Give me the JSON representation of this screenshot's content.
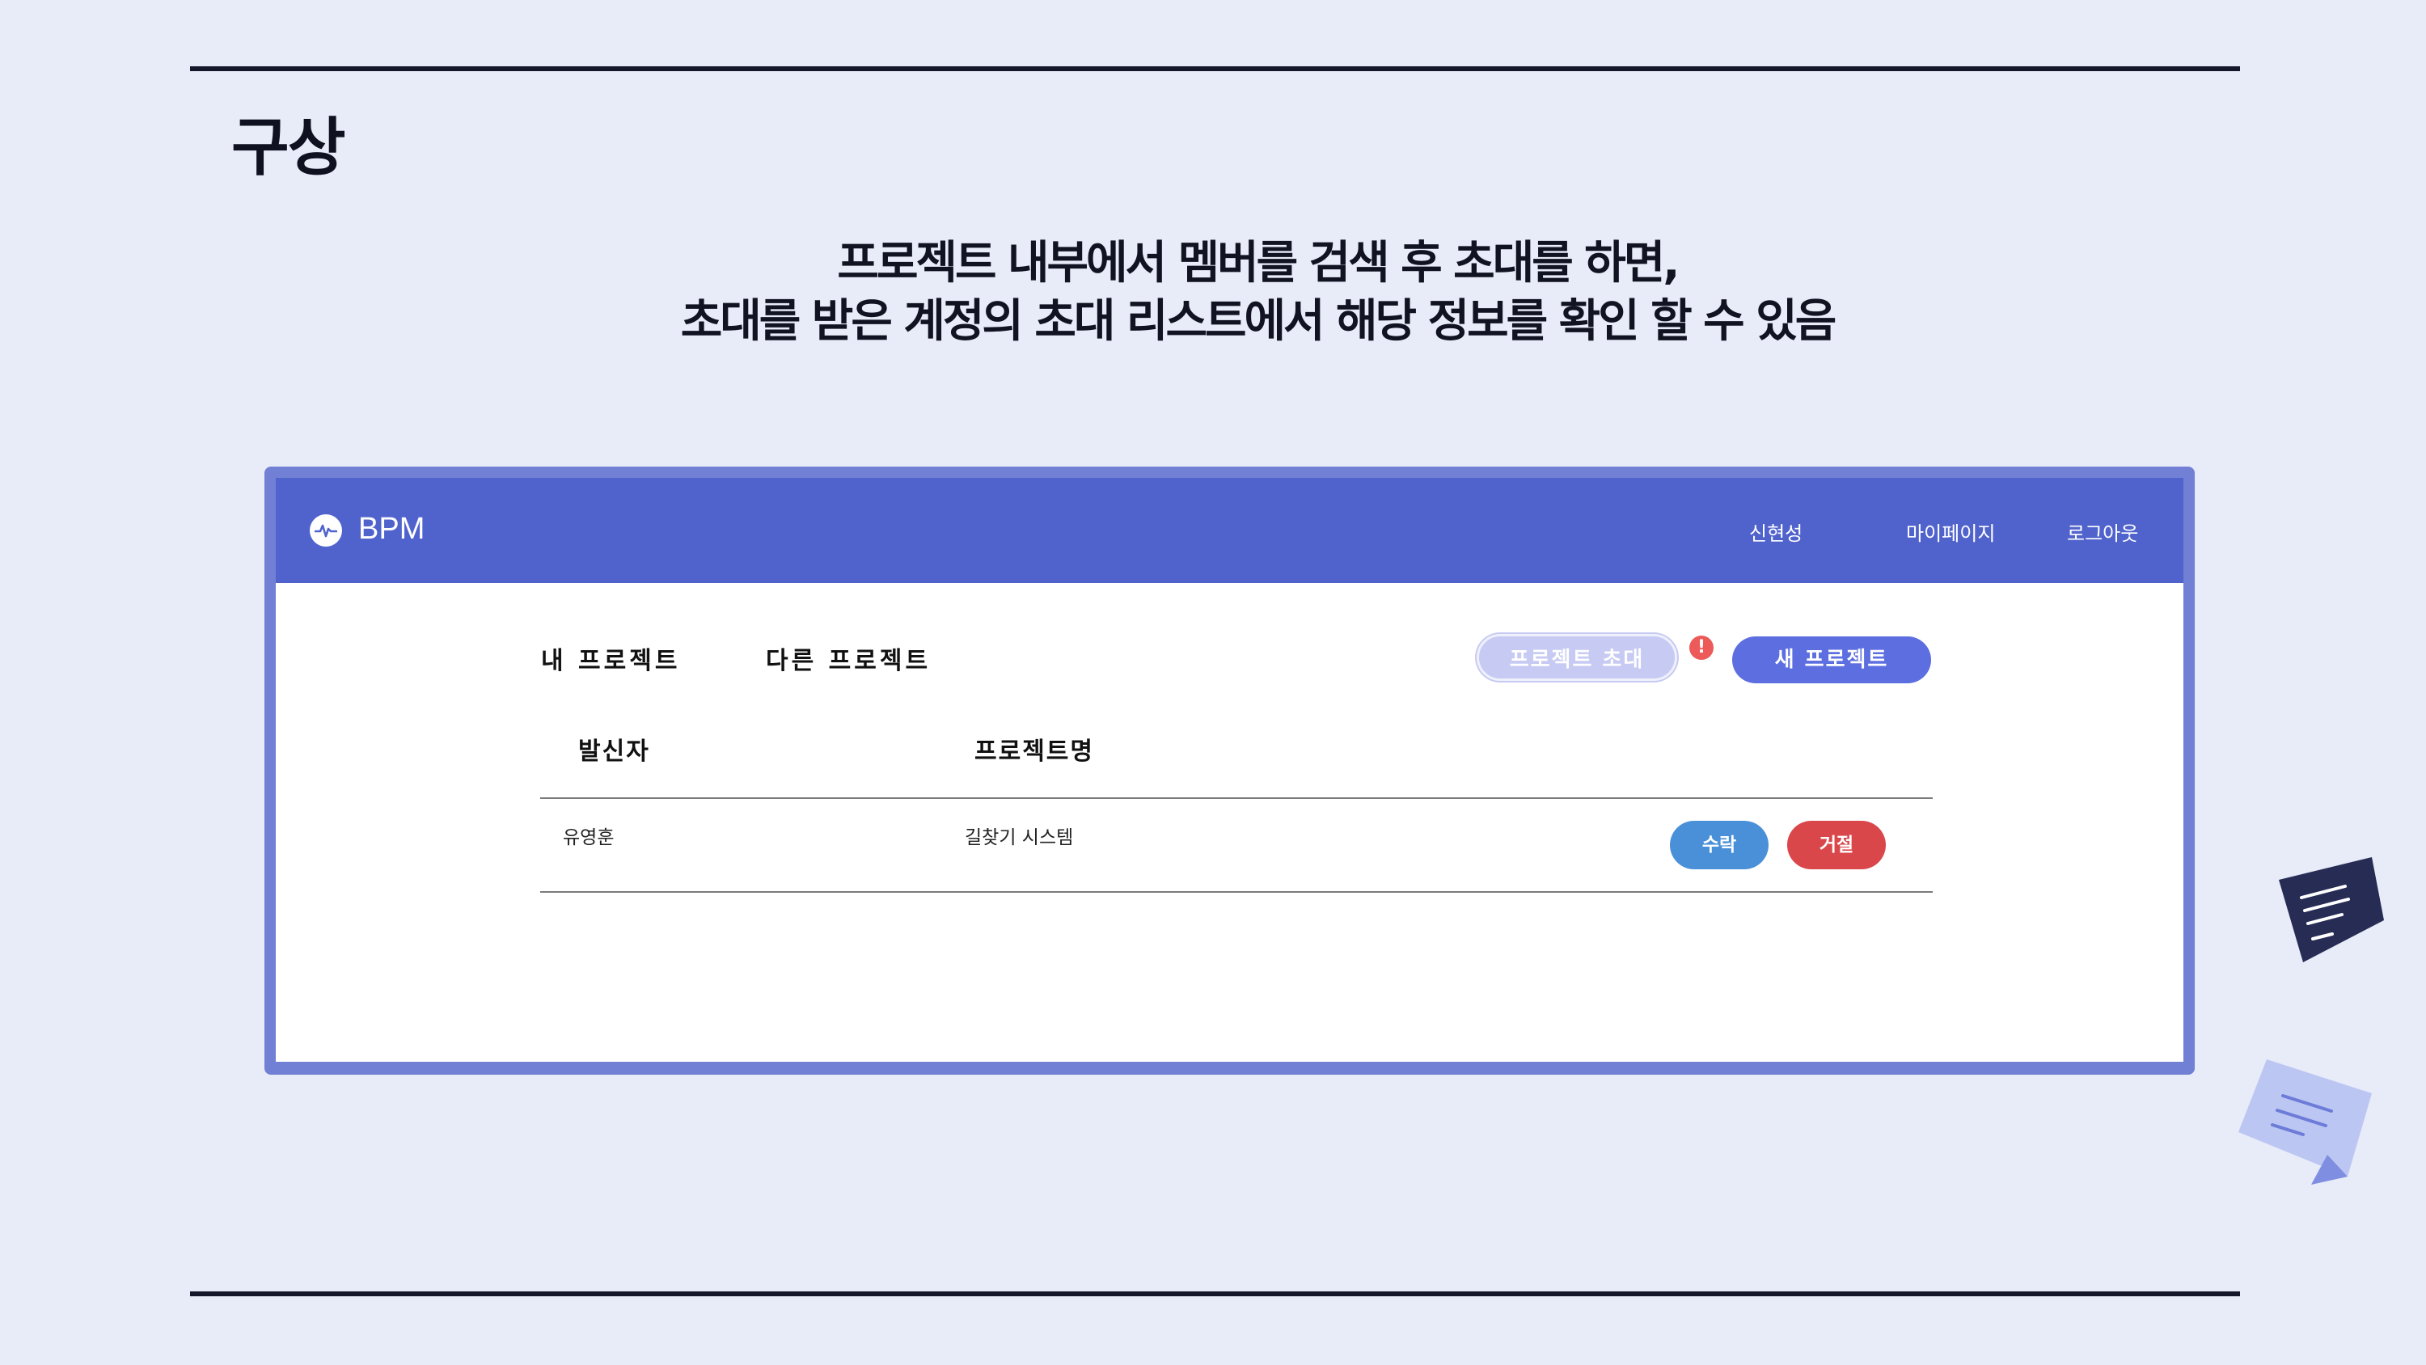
{
  "slide": {
    "title": "구상",
    "description_line1": "프로젝트 내부에서 멤버를 검색 후 초대를 하면,",
    "description_line2": "초대를 받은 계정의 초대 리스트에서 해당 정보를 확인 할 수 있음"
  },
  "app": {
    "brand": "BPM",
    "brand_icon": "pulse-icon",
    "nav": {
      "user": "신현성",
      "mypage": "마이페이지",
      "logout": "로그아웃"
    },
    "tabs": {
      "mine": "내 프로젝트",
      "other": "다른 프로젝트"
    },
    "buttons": {
      "invite": "프로젝트 초대",
      "new_project": "새 프로젝트",
      "alert": "!"
    },
    "table": {
      "headers": {
        "sender": "발신자",
        "project": "프로젝트명"
      },
      "rows": [
        {
          "sender": "유영훈",
          "project": "길찾기 시스템",
          "accept": "수락",
          "reject": "거절"
        }
      ]
    },
    "colors": {
      "navbar": "#5063cd",
      "frame": "#717fd5",
      "accept": "#4a90d9",
      "reject": "#d9474b",
      "new_project": "#5c6ee0",
      "invite": "#c7caf2",
      "alert": "#ec5a5a"
    }
  },
  "decorations": {
    "note_icons": [
      "document-note-icon",
      "paper-note-icon"
    ]
  }
}
